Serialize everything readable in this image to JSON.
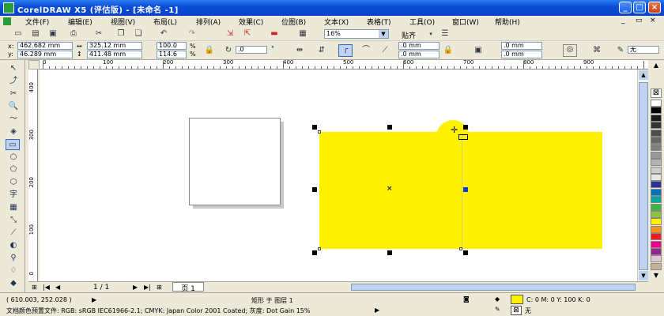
{
  "window": {
    "title": "CorelDRAW X5 (评估版) - [未命名 -1]",
    "min": "_",
    "max": "□",
    "close": "×",
    "mdi_min": "_",
    "mdi_restore": "▭",
    "mdi_close": "×"
  },
  "menu": [
    {
      "label": "文件(F)",
      "name": "menu-file"
    },
    {
      "label": "编辑(E)",
      "name": "menu-edit"
    },
    {
      "label": "视图(V)",
      "name": "menu-view"
    },
    {
      "label": "布局(L)",
      "name": "menu-layout"
    },
    {
      "label": "排列(A)",
      "name": "menu-arrange"
    },
    {
      "label": "效果(C)",
      "name": "menu-effects"
    },
    {
      "label": "位图(B)",
      "name": "menu-bitmaps"
    },
    {
      "label": "文本(X)",
      "name": "menu-text"
    },
    {
      "label": "表格(T)",
      "name": "menu-table"
    },
    {
      "label": "工具(O)",
      "name": "menu-tools"
    },
    {
      "label": "窗口(W)",
      "name": "menu-window"
    },
    {
      "label": "帮助(H)",
      "name": "menu-help"
    }
  ],
  "toolbar1": {
    "zoom": "16%",
    "snap_label": "贴齐",
    "icons": [
      "new-icon",
      "open-icon",
      "save-icon",
      "print-icon",
      "cut-icon",
      "copy-icon",
      "paste-icon",
      "undo-icon",
      "redo-icon",
      "import-icon",
      "export-icon",
      "app-launcher-icon",
      "welcome-icon"
    ]
  },
  "propbar": {
    "x": "462.682 mm",
    "y": "46.289 mm",
    "w": "325.12 mm",
    "h": "411.48 mm",
    "sx": "100.0",
    "sy": "114.6",
    "pct": "%",
    "rotation": ".0",
    "deg": "°",
    "corner_tl": ".0 mm",
    "corner_bl": ".0 mm",
    "corner_tr": ".0 mm",
    "corner_br": ".0 mm",
    "outline": "无"
  },
  "hruler_ticks": [
    "0",
    "100",
    "200",
    "300",
    "400",
    "500",
    "600",
    "700",
    "800",
    "900"
  ],
  "vruler_ticks": [
    "400",
    "300",
    "200",
    "100",
    "0"
  ],
  "statusbar": {
    "coords": "( 610.003, 252.028 )",
    "object_info": "矩形 于 图层 1",
    "fill_info": "C: 0 M: 0 Y: 100 K: 0",
    "outline_info": "无",
    "color_profile": "文档颜色预置文件: RGB: sRGB IEC61966-2.1; CMYK: Japan Color 2001 Coated; 灰度: Dot Gain 15%"
  },
  "pagebar": {
    "page_count": "1 / 1",
    "page_tab": "页 1"
  },
  "colors": {
    "fill": "#fff200",
    "titlebar": "#0a4fd6",
    "chrome": "#ece9d8"
  },
  "palette": [
    "#ffffff",
    "#000000",
    "#1a1a1a",
    "#333333",
    "#4d4d4d",
    "#666666",
    "#808080",
    "#999999",
    "#b3b3b3",
    "#cccccc",
    "#e6e6e6",
    "#2e3192",
    "#0071bc",
    "#00a99d",
    "#39b54a",
    "#8cc63f",
    "#fff200",
    "#f7931e",
    "#ed1c24",
    "#ec008c",
    "#92278f",
    "#e4c6d0",
    "#c7b299"
  ]
}
